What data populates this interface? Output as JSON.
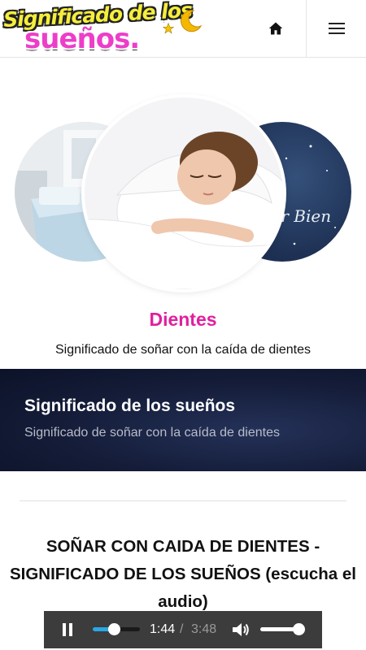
{
  "header": {
    "logo_line1": "Significado de los",
    "logo_line2": "sueños.",
    "home_icon": "home-icon",
    "menu_icon": "hamburger-menu-icon"
  },
  "hero": {
    "right_image_text": "mir Bien"
  },
  "category": {
    "title": "Dientes",
    "subtitle": "Significado de soñar con la caída de dientes"
  },
  "banner": {
    "title": "Significado de los sueños",
    "subtitle": "Significado de soñar con la caída de dientes"
  },
  "article": {
    "title": "SOÑAR CON CAIDA DE DIENTES - SIGNIFICADO DE LOS SUEÑOS (escucha el audio)"
  },
  "player": {
    "current_time": "1:44",
    "separator": "/",
    "total_time": "3:48",
    "progress": 0.456,
    "volume": 0.9,
    "accent_color": "#2aa7e6"
  }
}
